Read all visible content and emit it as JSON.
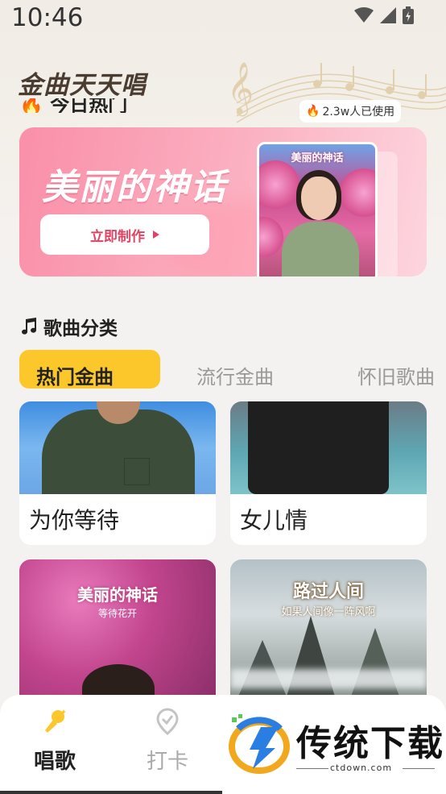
{
  "status_bar": {
    "time": "10:46"
  },
  "app": {
    "title": "金曲天天唱",
    "partial_heading": "今日热门"
  },
  "banner": {
    "title": "美丽的神话",
    "button_label": "立即制作",
    "card_title": "美丽的神话",
    "usage": "2.3w人已使用"
  },
  "category": {
    "title": "歌曲分类",
    "tabs": [
      {
        "label": "热门金曲",
        "active": true
      },
      {
        "label": "流行金曲",
        "active": false
      },
      {
        "label": "怀旧歌曲",
        "active": false
      }
    ]
  },
  "songs": [
    {
      "name": "为你等待"
    },
    {
      "name": "女儿情"
    },
    {
      "name": "",
      "cover_title": "美丽的神话",
      "cover_subtitle": "等待花开"
    },
    {
      "name": "",
      "cover_title": "路过人间",
      "cover_subtitle": "如果人间像一阵风啊"
    }
  ],
  "bottom_nav": [
    {
      "label": "唱歌",
      "icon": "microphone-icon",
      "active": true
    },
    {
      "label": "打卡",
      "icon": "checkin-pin-icon",
      "active": false
    }
  ],
  "watermark": {
    "brand": "传统下载",
    "url": "ctdown.com"
  },
  "colors": {
    "accent_yellow": "#fcc72b",
    "banner_pink": "#fa8fa9",
    "button_text": "#e04364"
  }
}
